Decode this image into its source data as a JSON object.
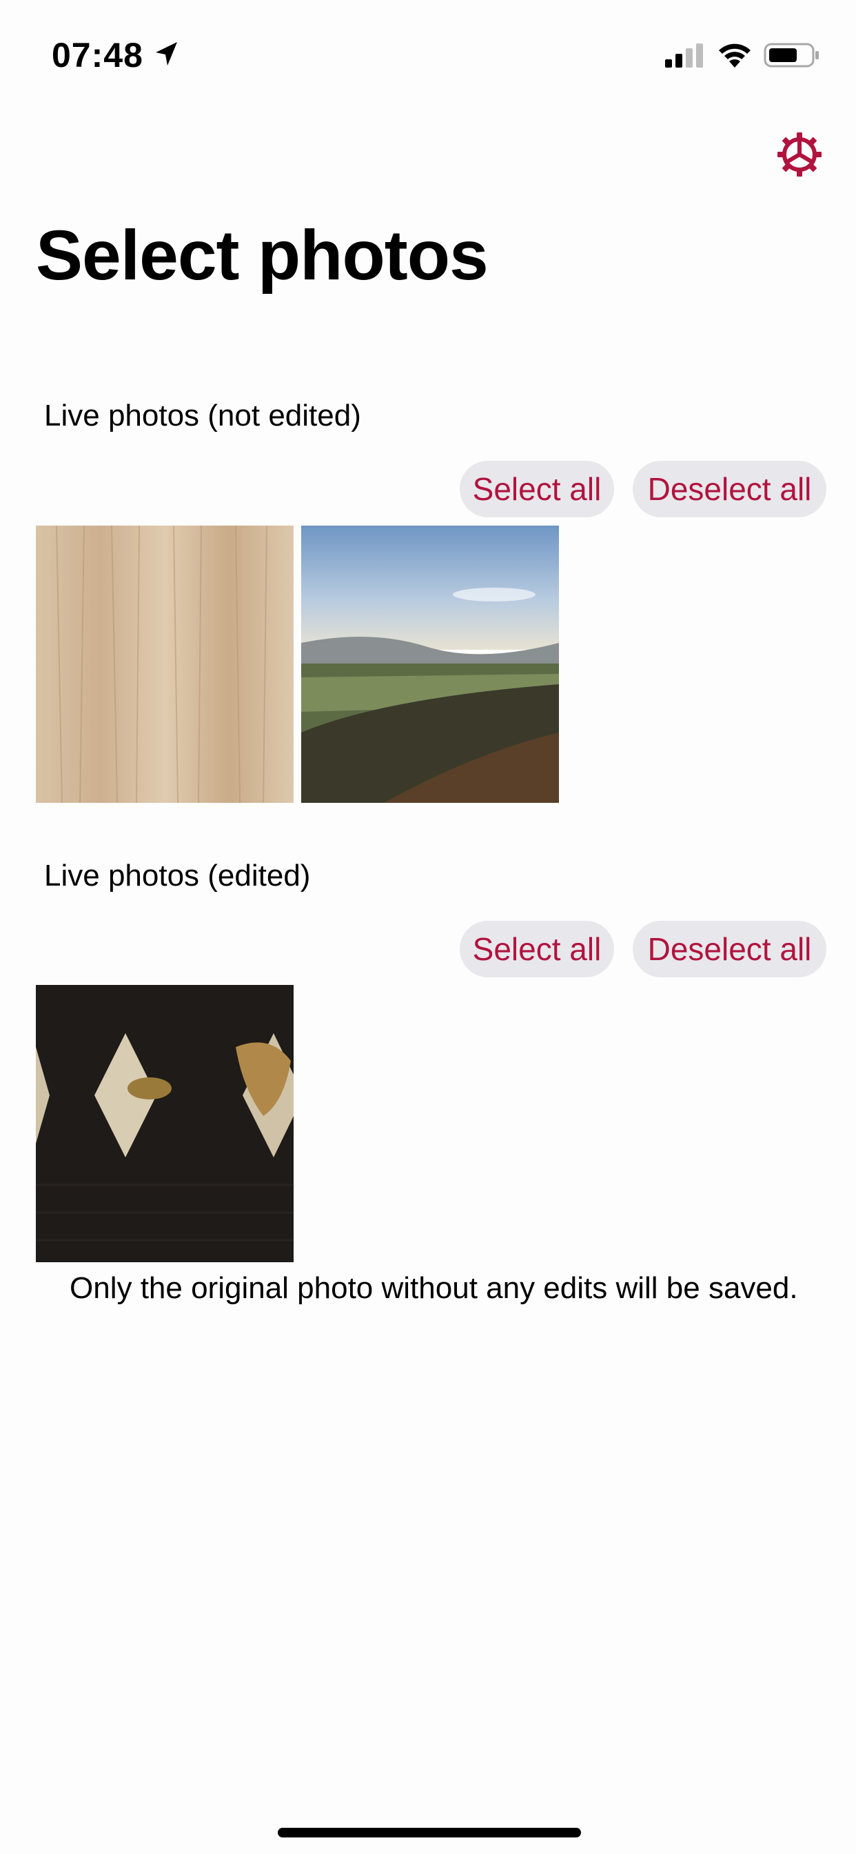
{
  "status_bar": {
    "time": "07:48",
    "icons": [
      "location-arrow-icon",
      "cellular-signal-icon",
      "wifi-icon",
      "battery-icon"
    ]
  },
  "header": {
    "settings_icon": "gear-icon",
    "title": "Select photos"
  },
  "sections": [
    {
      "title": "Live photos (not edited)",
      "select_all_label": "Select all",
      "deselect_all_label": "Deselect all",
      "photos": [
        "wood-texture-photo",
        "valley-landscape-photo"
      ]
    },
    {
      "title": "Live photos (edited)",
      "select_all_label": "Select all",
      "deselect_all_label": "Deselect all",
      "photos": [
        "black-knit-with-gold-figures-photo"
      ]
    }
  ],
  "note": "Only the original photo without any edits will be saved.",
  "colors": {
    "accent": "#b0143e",
    "pill_background": "#e8e7ec",
    "background": "#fdfdfd"
  }
}
